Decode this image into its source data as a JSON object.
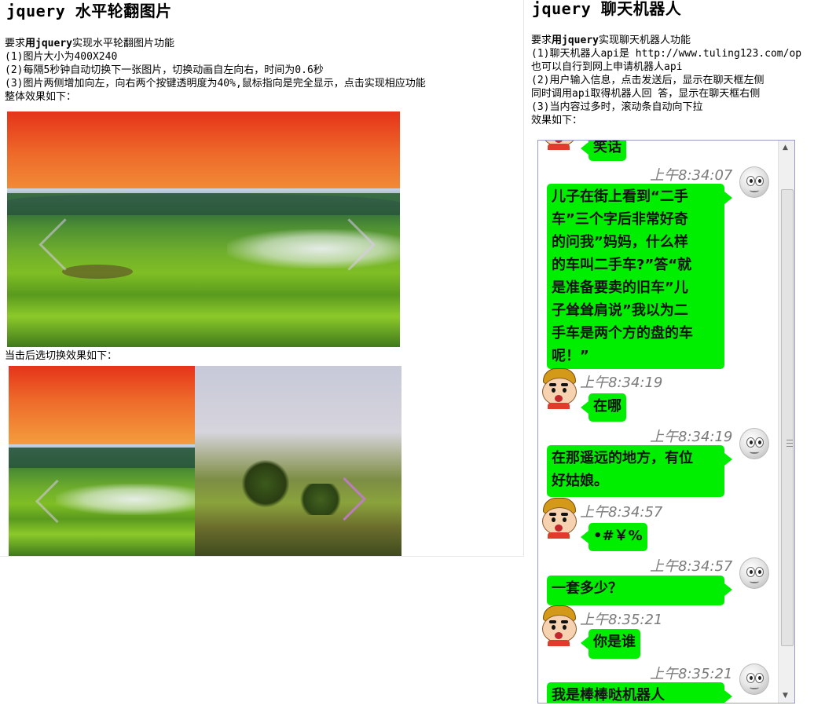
{
  "left": {
    "title": "jquery 水平轮翻图片",
    "intro_prefix": "要求",
    "intro_bold": "用jquery",
    "intro_suffix": "实现水平轮翻图片功能",
    "req1": "(1)图片大小为400X240",
    "req2": "(2)每隔5秒钟自动切换下一张图片，切换动画自左向右，时间为0.6秒",
    "req3": "(3)图片两侧增加向左，向右两个按键透明度为40%,鼠标指向是完全显示，点击实现相应功能",
    "req4": "整体效果如下：",
    "caption": "当击后选切换效果如下：",
    "prev_icon": "chevron-left-icon",
    "next_icon": "chevron-right-icon"
  },
  "right": {
    "title": "jquery 聊天机器人",
    "intro_prefix": "要求",
    "intro_bold": "用jquery",
    "intro_suffix": "实现聊天机器人功能",
    "req1": "(1)聊天机器人api是 http://www.tuling123.com/op",
    "req2": "也可以自行到网上申请机器人api",
    "req3": "(2)用户输入信息，点击发送后，显示在聊天框左侧",
    "req4": "同时调用api取得机器人回 答，显示在聊天框右侧",
    "req5": "(3)当内容过多时，滚动条自动向下拉",
    "req6": "效果如下："
  },
  "chat": {
    "messages": [
      {
        "from": "user",
        "time": "",
        "text": "笑话"
      },
      {
        "from": "bot",
        "time": "上午8:34:07",
        "lines": [
          "儿子在街上看到“二手",
          "车”三个字后非常好奇",
          "的问我”妈妈，什么样",
          "的车叫二手车?”答“就",
          "是准备要卖的旧车”儿",
          "子耸耸肩说”我以为二",
          "手车是两个方的盘的车",
          "呢！”"
        ]
      },
      {
        "from": "user",
        "time": "上午8:34:19",
        "text": "在哪"
      },
      {
        "from": "bot",
        "time": "上午8:34:19",
        "lines": [
          "在那遥远的地方，有位",
          "好姑娘。"
        ]
      },
      {
        "from": "user",
        "time": "上午8:34:57",
        "text": "•#￥%"
      },
      {
        "from": "bot",
        "time": "上午8:34:57",
        "lines": [
          "一套多少？"
        ]
      },
      {
        "from": "user",
        "time": "上午8:35:21",
        "text": "你是谁"
      },
      {
        "from": "bot",
        "time": "上午8:35:21",
        "lines": [
          "我是棒棒哒机器人"
        ]
      }
    ],
    "bubble_color": "#00ee00",
    "bot_avatar": "robot-face-icon",
    "user_avatar": "cartoon-boy-icon"
  }
}
